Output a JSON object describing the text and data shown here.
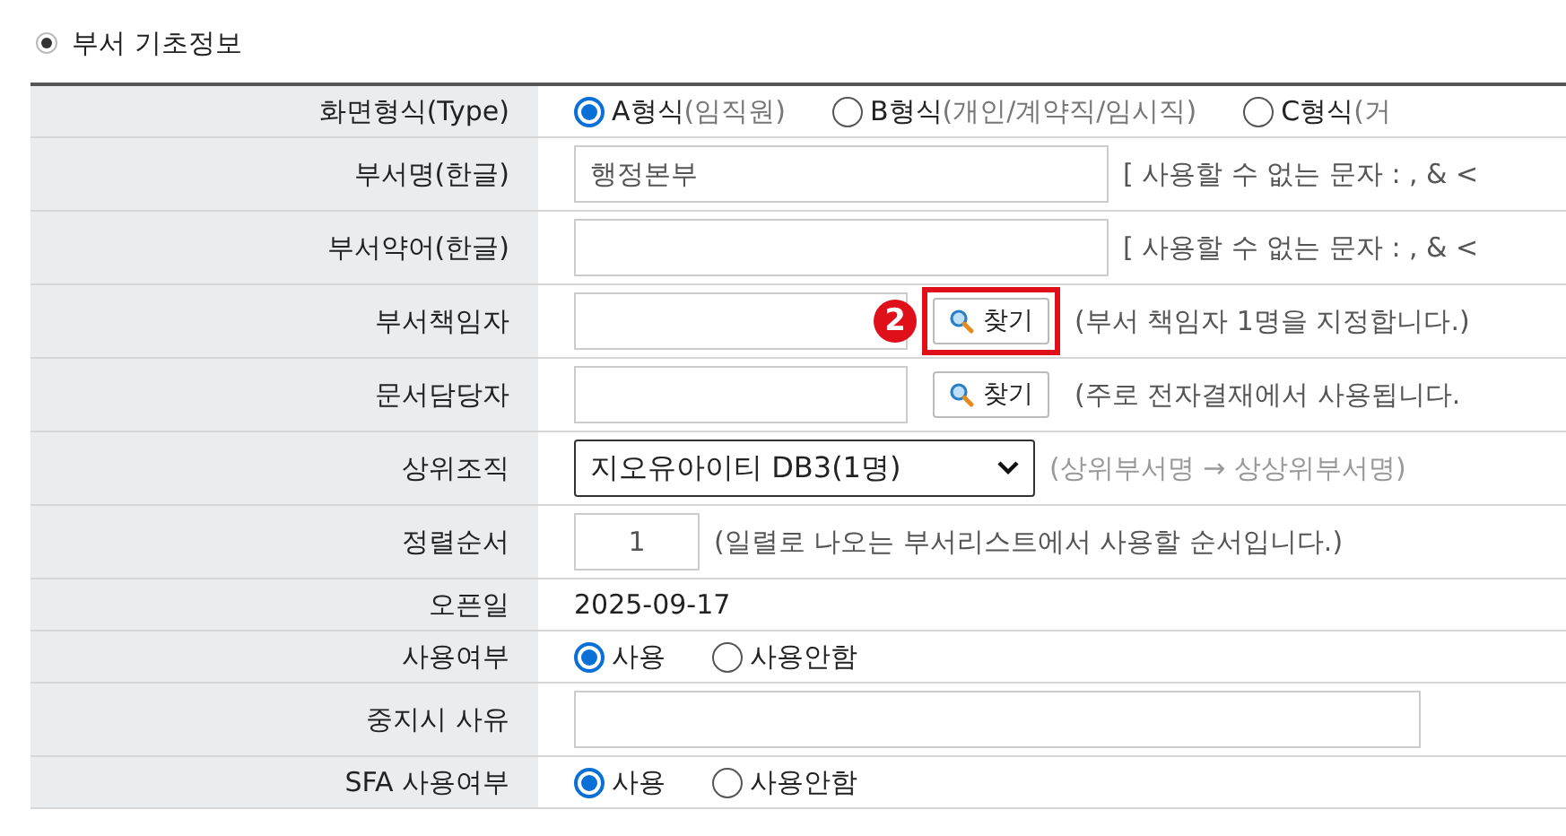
{
  "section": {
    "title": "부서 기초정보"
  },
  "rows": [
    {
      "label": "화면형식(Type)",
      "kind": "radios",
      "options": [
        {
          "label": "A형식",
          "sub": "(임직원)",
          "selected": true
        },
        {
          "label": "B형식",
          "sub": "(개인/계약직/임시직)",
          "selected": false
        },
        {
          "label": "C형식",
          "sub": "(거",
          "selected": false
        }
      ]
    },
    {
      "label": "부서명(한글)",
      "kind": "input",
      "value": "행정본부",
      "hint": "[ 사용할 수 없는 문자 : , & <"
    },
    {
      "label": "부서약어(한글)",
      "kind": "input",
      "hint": "[ 사용할 수 없는 문자 : , & <"
    },
    {
      "label": "부서책임자",
      "kind": "search",
      "button": "찾기",
      "highlighted": true,
      "callout": "2",
      "hint": "(부서 책임자 1명을 지정합니다.)"
    },
    {
      "label": "문서담당자",
      "kind": "search",
      "button": "찾기",
      "highlighted": false,
      "hint": "(주로 전자결재에서 사용됩니다."
    },
    {
      "label": "상위조직",
      "kind": "select",
      "value": "지오유아이티 DB3(1명)",
      "hint": "(상위부서명 → 상상위부서명)"
    },
    {
      "label": "정렬순서",
      "kind": "number",
      "value": "1",
      "hint": "(일렬로 나오는 부서리스트에서 사용할 순서입니다.)"
    },
    {
      "label": "오픈일",
      "kind": "text",
      "value": "2025-09-17"
    },
    {
      "label": "사용여부",
      "kind": "radios",
      "options": [
        {
          "label": "사용",
          "selected": true
        },
        {
          "label": "사용안함",
          "selected": false
        }
      ]
    },
    {
      "label": "중지시 사유",
      "kind": "input"
    },
    {
      "label": "SFA 사용여부",
      "kind": "radios",
      "options": [
        {
          "label": "사용",
          "selected": true
        },
        {
          "label": "사용안함",
          "selected": false
        }
      ]
    }
  ]
}
